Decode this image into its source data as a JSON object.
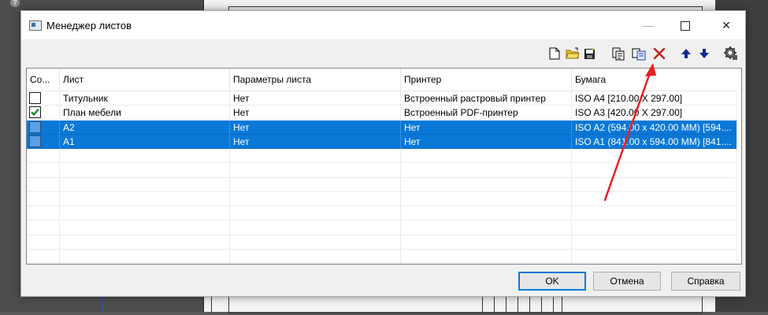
{
  "dialog": {
    "title": "Менеджер листов",
    "window_buttons": {
      "minimize": "—",
      "close": "✕"
    }
  },
  "toolbar": {
    "icons": [
      "new-sheet-icon",
      "open-folder-icon",
      "save-icon",
      "copy-settings-icon",
      "paste-icon",
      "delete-icon",
      "move-up-icon",
      "move-down-icon",
      "settings-icon"
    ]
  },
  "table": {
    "columns": [
      "Со...",
      "Лист",
      "Параметры листа",
      "Принтер",
      "Бумага"
    ],
    "rows": [
      {
        "checked": false,
        "selected": false,
        "sheet": "Титульник",
        "params": "Нет",
        "printer": "Встроенный растровый принтер",
        "paper": "ISO A4 [210.00 X 297.00]"
      },
      {
        "checked": true,
        "selected": false,
        "sheet": "План мебели",
        "params": "Нет",
        "printer": "Встроенный PDF-принтер",
        "paper": "ISO A3 [420.00 X 297.00]"
      },
      {
        "checked": false,
        "selected": true,
        "sheet": "A2",
        "params": "Нет",
        "printer": "Нет",
        "paper": "ISO A2 (594.00 x 420.00 MM) [594...."
      },
      {
        "checked": false,
        "selected": true,
        "sheet": "A1",
        "params": "Нет",
        "printer": "Нет",
        "paper": "ISO A1 (841.00 x 594.00 MM) [841...."
      }
    ]
  },
  "buttons": {
    "ok": "OK",
    "cancel": "Отмена",
    "help": "Справка"
  },
  "colors": {
    "selection": "#0a78d7",
    "annotation_arrow": "#e82020",
    "delete_icon": "#c0201a"
  },
  "background": {
    "help_icon": "?"
  }
}
